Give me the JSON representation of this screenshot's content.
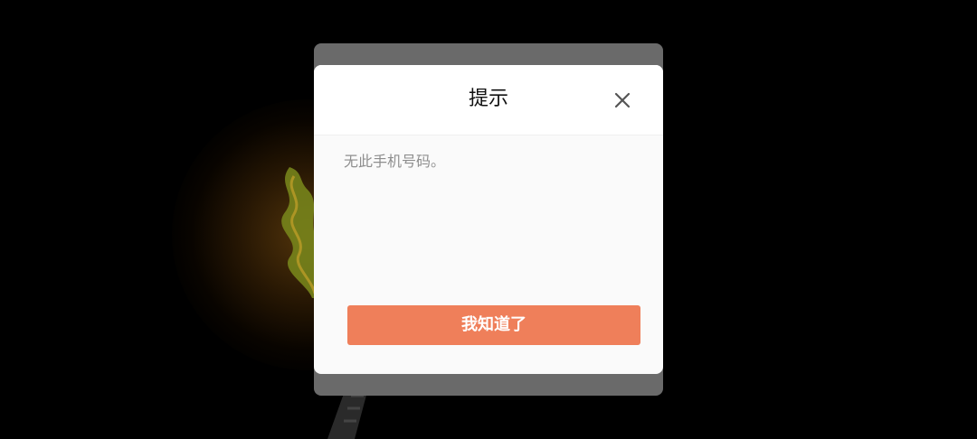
{
  "dialog": {
    "title": "提示",
    "message": "无此手机号码。",
    "confirm_label": "我知道了",
    "close_icon": "close-icon"
  },
  "colors": {
    "overlay": "#000000",
    "frame": "#6a6a6a",
    "header": "#ffffff",
    "body": "#fafafa",
    "accent": "#ef7f5a",
    "message_text": "#8e8e8e"
  }
}
